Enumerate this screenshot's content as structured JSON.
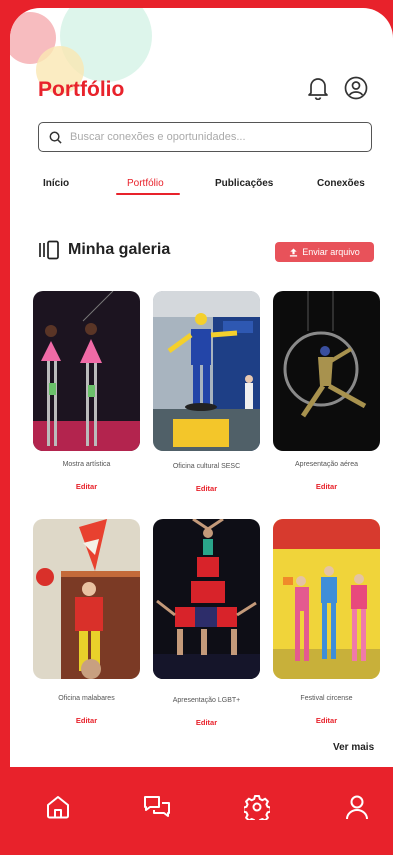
{
  "header": {
    "title": "Portfólio"
  },
  "search": {
    "placeholder": "Buscar conexões e oportunidades..."
  },
  "tabs": [
    {
      "label": "Início",
      "active": false
    },
    {
      "label": "Portfólio",
      "active": true
    },
    {
      "label": "Publicações",
      "active": false
    },
    {
      "label": "Conexões",
      "active": false
    }
  ],
  "gallery": {
    "title": "Minha galeria",
    "upload_label": "Enviar arquivo",
    "items": [
      {
        "caption": "Mostra artística",
        "edit": "Editar"
      },
      {
        "caption": "Oficina cultural SESC",
        "edit": "Editar"
      },
      {
        "caption": "Apresentação aérea",
        "edit": "Editar"
      },
      {
        "caption": "Oficina malabares",
        "edit": "Editar"
      },
      {
        "caption": "Apresentação LGBT+",
        "edit": "Editar"
      },
      {
        "caption": "Festival circense",
        "edit": "Editar"
      }
    ],
    "more": "Ver mais"
  },
  "bottom_nav": [
    {
      "icon": "home-icon"
    },
    {
      "icon": "chat-icon"
    },
    {
      "icon": "settings-icon"
    },
    {
      "icon": "profile-icon"
    }
  ],
  "colors": {
    "accent": "#e8222b",
    "button": "#e8525a"
  }
}
